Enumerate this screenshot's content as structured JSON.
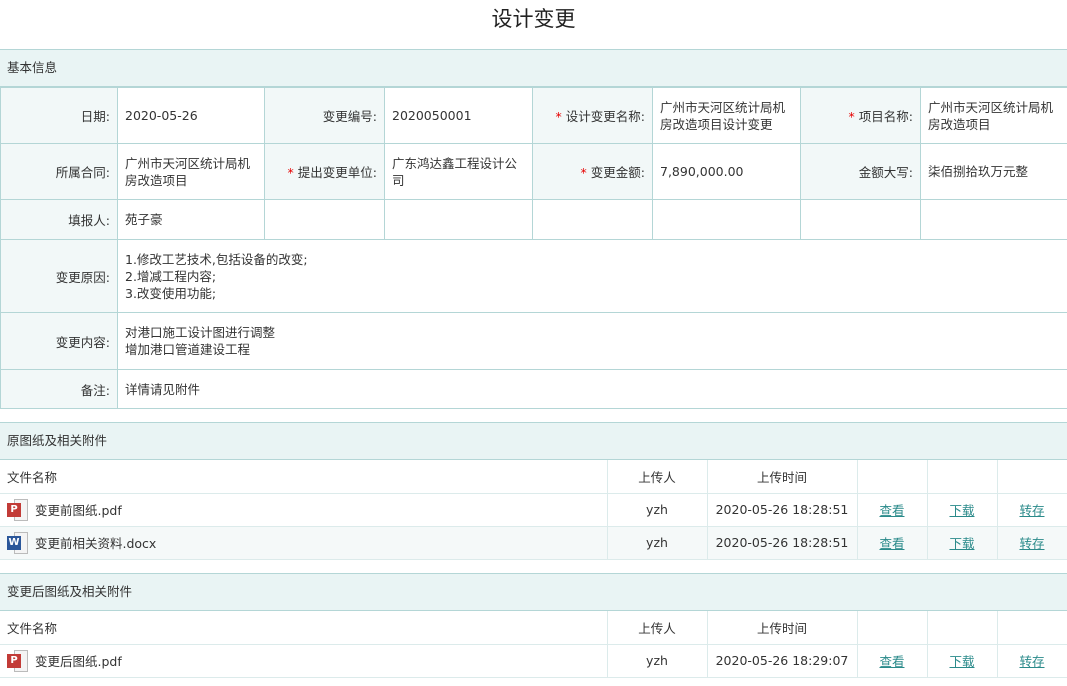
{
  "page": {
    "title": "设计变更"
  },
  "basic": {
    "section_title": "基本信息",
    "date_label": "日期:",
    "date_value": "2020-05-26",
    "change_no_label": "变更编号:",
    "change_no_value": "2020050001",
    "change_name_label": "设计变更名称:",
    "change_name_value": "广州市天河区统计局机房改造项目设计变更",
    "project_label": "项目名称:",
    "project_value": "广州市天河区统计局机房改造项目",
    "contract_label": "所属合同:",
    "contract_value": "广州市天河区统计局机房改造项目",
    "unit_label": "提出变更单位:",
    "unit_value": "广东鸿达鑫工程设计公司",
    "amount_label": "变更金额:",
    "amount_value": "7,890,000.00",
    "amount_cn_label": "金额大写:",
    "amount_cn_value": "柒佰捌拾玖万元整",
    "reporter_label": "填报人:",
    "reporter_value": "苑子豪",
    "reason_label": "变更原因:",
    "reason_value": "1.修改工艺技术,包括设备的改变;\n2.增减工程内容;\n3.改变使用功能;",
    "content_label": "变更内容:",
    "content_value": "对港口施工设计图进行调整\n增加港口管道建设工程",
    "remark_label": "备注:",
    "remark_value": "详情请见附件"
  },
  "original_files": {
    "section_title": "原图纸及相关附件",
    "headers": {
      "name": "文件名称",
      "uploader": "上传人",
      "time": "上传时间"
    },
    "rows": [
      {
        "icon": "pdf-file-icon",
        "name": "变更前图纸.pdf",
        "uploader": "yzh",
        "time": "2020-05-26 18:28:51",
        "view": "查看",
        "download": "下载",
        "save": "转存"
      },
      {
        "icon": "word-file-icon",
        "name": "变更前相关资料.docx",
        "uploader": "yzh",
        "time": "2020-05-26 18:28:51",
        "view": "查看",
        "download": "下载",
        "save": "转存"
      }
    ]
  },
  "changed_files": {
    "section_title": "变更后图纸及相关附件",
    "headers": {
      "name": "文件名称",
      "uploader": "上传人",
      "time": "上传时间"
    },
    "rows": [
      {
        "icon": "pdf-file-icon",
        "name": "变更后图纸.pdf",
        "uploader": "yzh",
        "time": "2020-05-26 18:29:07",
        "view": "查看",
        "download": "下载",
        "save": "转存"
      }
    ]
  },
  "colors": {
    "header_bg": "#e9f4f4",
    "border": "#b4d6d6",
    "link": "#2a8a8a",
    "required": "#e60000",
    "pdf_badge": "#c23b37",
    "word_badge": "#2b579a"
  }
}
